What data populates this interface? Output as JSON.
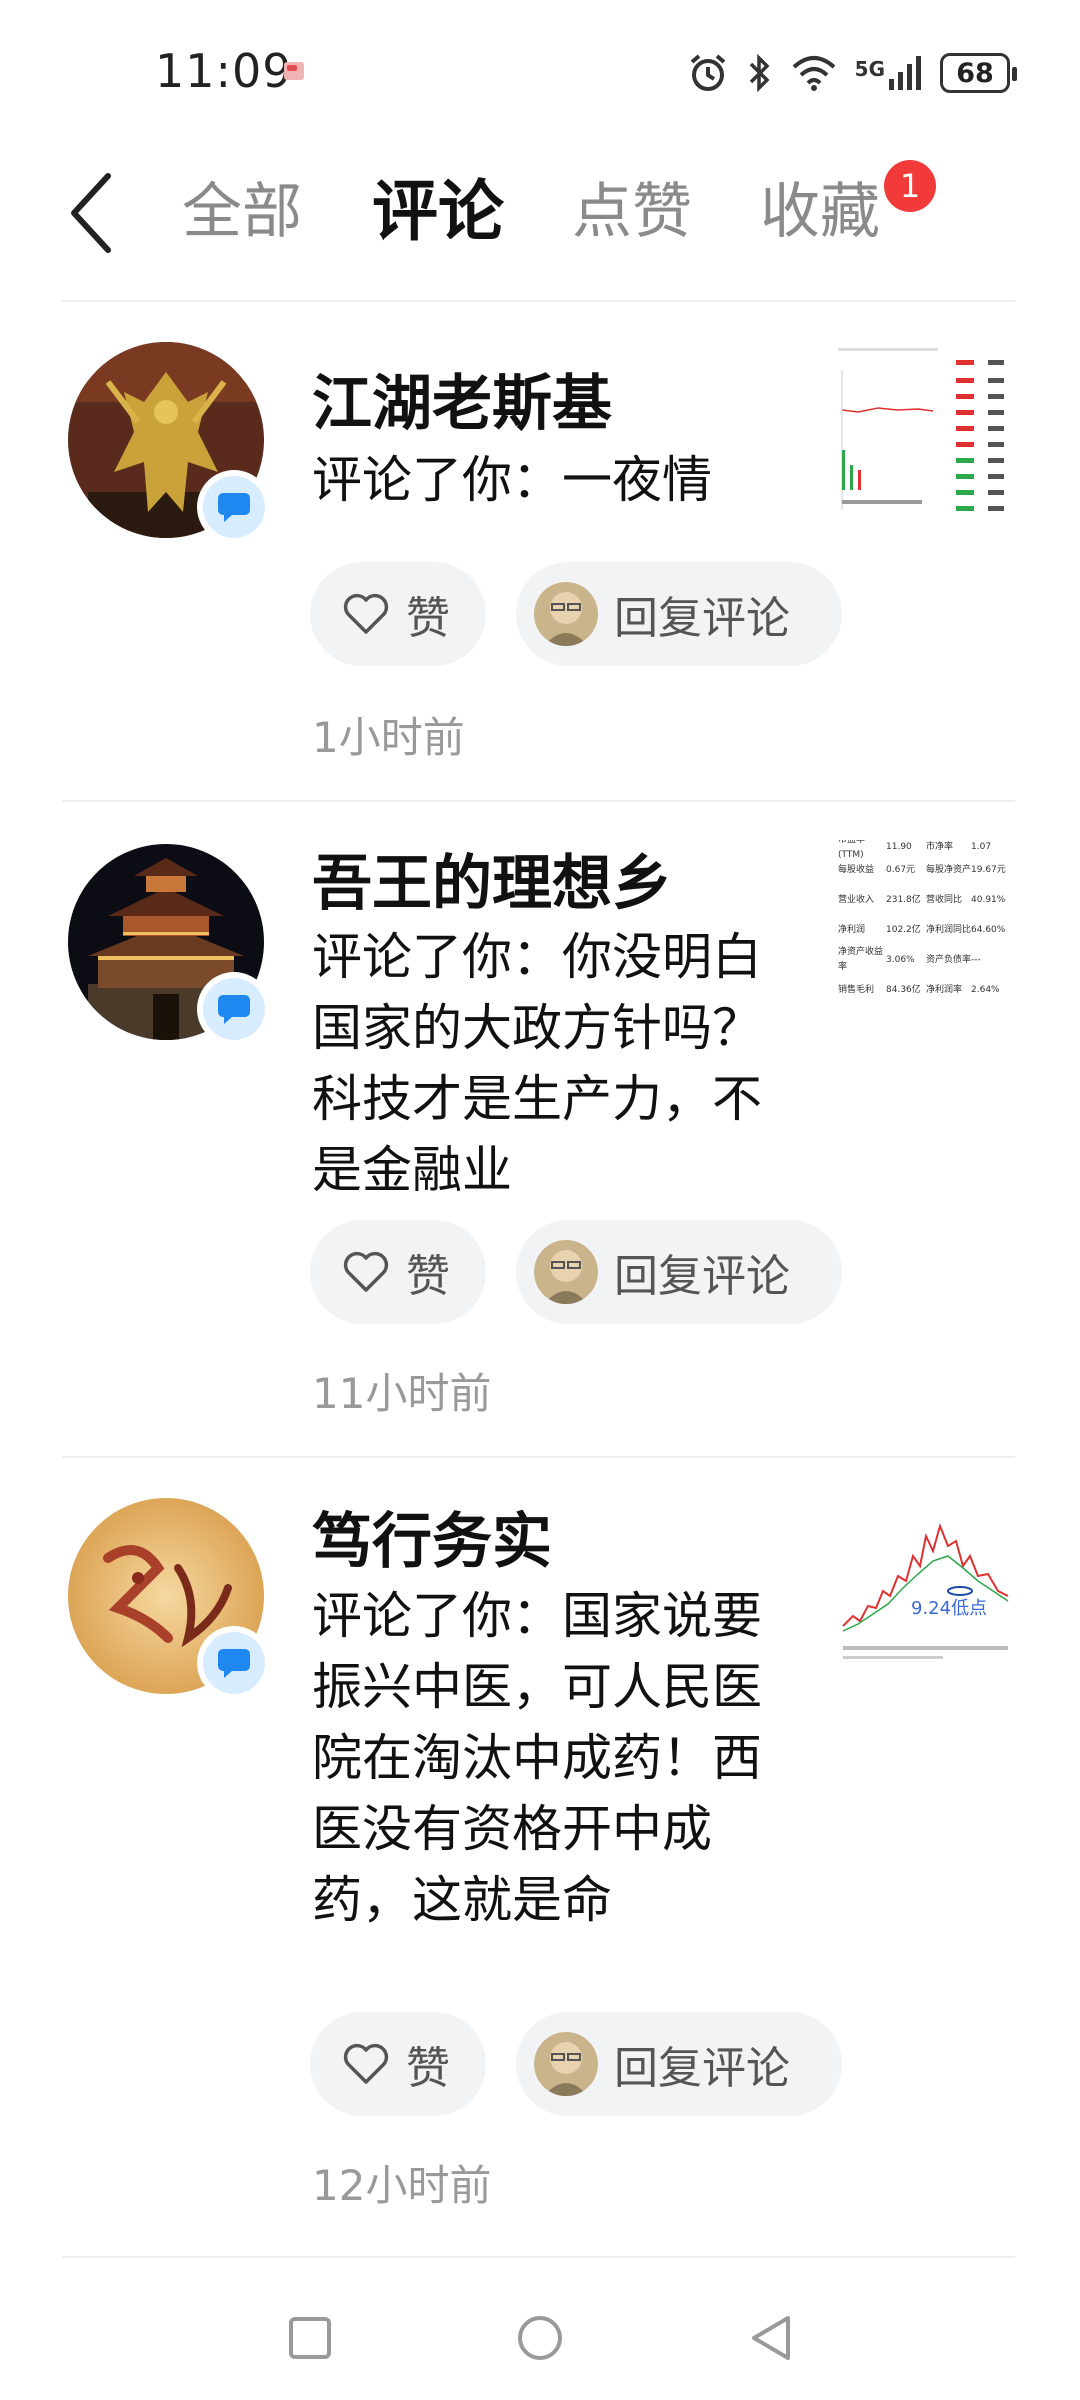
{
  "status_bar": {
    "time": "11:09",
    "network": "5G",
    "battery": "68"
  },
  "tabs": [
    {
      "label": "全部",
      "active": false
    },
    {
      "label": "评论",
      "active": true
    },
    {
      "label": "点赞",
      "active": false
    },
    {
      "label": "收藏",
      "active": false,
      "badge": "1"
    }
  ],
  "like_label": "赞",
  "reply_label": "回复评论",
  "items": [
    {
      "name": "江湖老斯基",
      "comment": "评论了你：一夜情",
      "time": "1小时前"
    },
    {
      "name": "吾王的理想乡",
      "comment": "评论了你：你没明白国家的大政方针吗？科技才是生产力，不是金融业",
      "time": "11小时前"
    },
    {
      "name": "笃行务实",
      "comment": "评论了你：国家说要振兴中医，可人民医院在淘汰中成药！西医没有资格开中成药，这就是命",
      "time": "12小时前"
    }
  ],
  "thumbnails": {
    "t2_rows": [
      [
        "市盈率(TTM)",
        "11.90",
        "市净率",
        "1.07"
      ],
      [
        "每股收益",
        "0.67元",
        "每股净资产",
        "19.67元"
      ],
      [
        "营业收入",
        "231.8亿",
        "营收同比",
        "40.91%"
      ],
      [
        "净利润",
        "102.2亿",
        "净利润同比",
        "64.60%"
      ],
      [
        "净资产收益率",
        "3.06%",
        "资产负债率",
        "---"
      ],
      [
        "销售毛利",
        "84.36亿",
        "净利润率",
        "2.64%"
      ]
    ],
    "t3_label": "9.24低点"
  },
  "colors": {
    "accent_blue": "#1e88f0",
    "badge_red": "#f23a3a",
    "muted_text": "#8a8a8a"
  }
}
